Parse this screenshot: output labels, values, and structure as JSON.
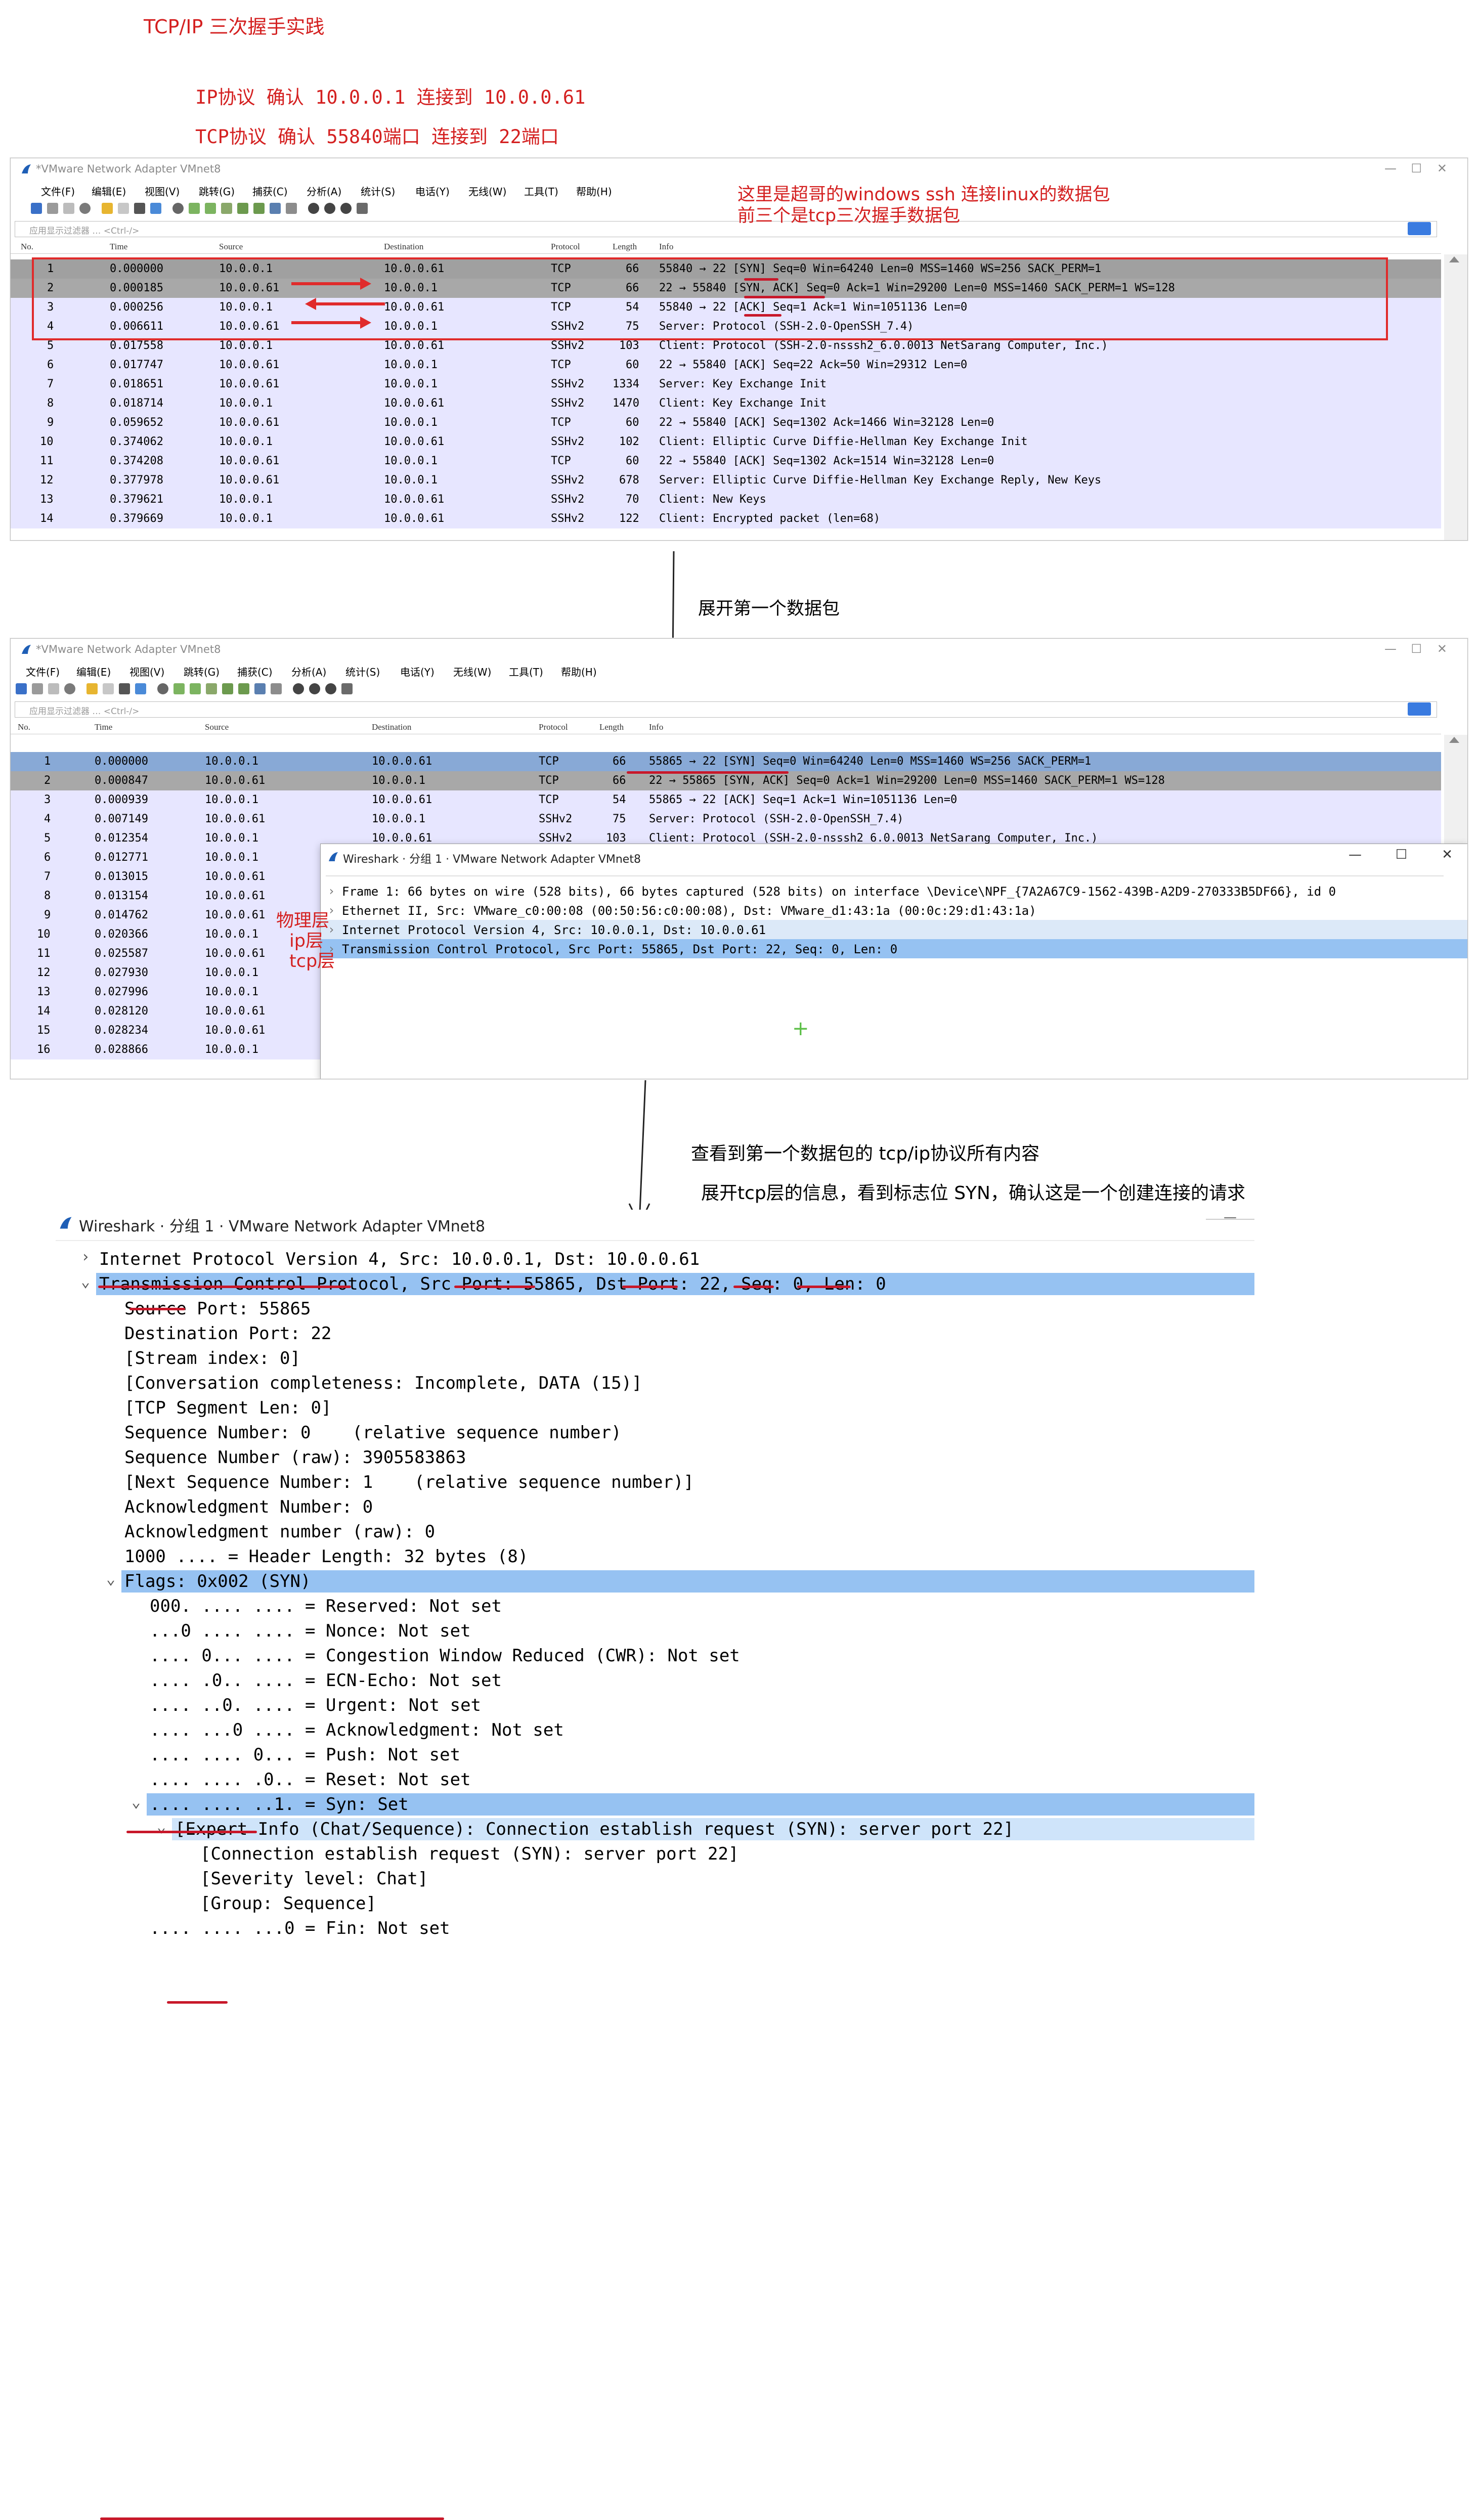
{
  "heading": {
    "title": "TCP/IP 三次握手实践",
    "line1": "IP协议 确认  10.0.0.1  连接到  10.0.0.61",
    "line2": "TCP协议  确认 55840端口  连接到  22端口"
  },
  "annotations": {
    "note1": "这里是超哥的windows  ssh 连接linux的数据包",
    "note2": "前三个是tcp三次握手数据包",
    "expand_first": "展开第一个数据包",
    "view_all": "查看到第一个数据包的 tcp/ip协议所有内容",
    "expand_tcp": "展开tcp层的信息，看到标志位 SYN，确认这是一个创建连接的请求",
    "layer_physical": "物理层",
    "layer_ip": "ip层",
    "layer_tcp": "tcp层"
  },
  "window": {
    "title": "*VMware Network Adapter VMnet8",
    "menu": [
      "文件(F)",
      "编辑(E)",
      "视图(V)",
      "跳转(G)",
      "捕获(C)",
      "分析(A)",
      "统计(S)",
      "电话(Y)",
      "无线(W)",
      "工具(T)",
      "帮助(H)"
    ],
    "filter_placeholder": "应用显示过滤器 … <Ctrl-/>",
    "columns": [
      "No.",
      "Time",
      "Source",
      "Destination",
      "Protocol",
      "Length",
      "Info"
    ],
    "min": "—",
    "max": "☐",
    "close": "✕"
  },
  "packets1": [
    {
      "no": "1",
      "time": "0.000000",
      "src": "10.0.0.1",
      "dst": "10.0.0.61",
      "proto": "TCP",
      "len": "66",
      "info": "55840 → 22 [SYN] Seq=0 Win=64240 Len=0 MSS=1460 WS=256 SACK_PERM=1"
    },
    {
      "no": "2",
      "time": "0.000185",
      "src": "10.0.0.61",
      "dst": "10.0.0.1",
      "proto": "TCP",
      "len": "66",
      "info": "22 → 55840 [SYN, ACK] Seq=0 Ack=1 Win=29200 Len=0 MSS=1460 SACK_PERM=1 WS=128"
    },
    {
      "no": "3",
      "time": "0.000256",
      "src": "10.0.0.1",
      "dst": "10.0.0.61",
      "proto": "TCP",
      "len": "54",
      "info": "55840 → 22 [ACK] Seq=1 Ack=1 Win=1051136 Len=0"
    },
    {
      "no": "4",
      "time": "0.006611",
      "src": "10.0.0.61",
      "dst": "10.0.0.1",
      "proto": "SSHv2",
      "len": "75",
      "info": "Server: Protocol (SSH-2.0-OpenSSH_7.4)"
    },
    {
      "no": "5",
      "time": "0.017558",
      "src": "10.0.0.1",
      "dst": "10.0.0.61",
      "proto": "SSHv2",
      "len": "103",
      "info": "Client: Protocol (SSH-2.0-nsssh2_6.0.0013 NetSarang Computer, Inc.)"
    },
    {
      "no": "6",
      "time": "0.017747",
      "src": "10.0.0.61",
      "dst": "10.0.0.1",
      "proto": "TCP",
      "len": "60",
      "info": "22 → 55840 [ACK] Seq=22 Ack=50 Win=29312 Len=0"
    },
    {
      "no": "7",
      "time": "0.018651",
      "src": "10.0.0.61",
      "dst": "10.0.0.1",
      "proto": "SSHv2",
      "len": "1334",
      "info": "Server: Key Exchange Init"
    },
    {
      "no": "8",
      "time": "0.018714",
      "src": "10.0.0.1",
      "dst": "10.0.0.61",
      "proto": "SSHv2",
      "len": "1470",
      "info": "Client: Key Exchange Init"
    },
    {
      "no": "9",
      "time": "0.059652",
      "src": "10.0.0.61",
      "dst": "10.0.0.1",
      "proto": "TCP",
      "len": "60",
      "info": "22 → 55840 [ACK] Seq=1302 Ack=1466 Win=32128 Len=0"
    },
    {
      "no": "10",
      "time": "0.374062",
      "src": "10.0.0.1",
      "dst": "10.0.0.61",
      "proto": "SSHv2",
      "len": "102",
      "info": "Client: Elliptic Curve Diffie-Hellman Key Exchange Init"
    },
    {
      "no": "11",
      "time": "0.374208",
      "src": "10.0.0.61",
      "dst": "10.0.0.1",
      "proto": "TCP",
      "len": "60",
      "info": "22 → 55840 [ACK] Seq=1302 Ack=1514 Win=32128 Len=0"
    },
    {
      "no": "12",
      "time": "0.377978",
      "src": "10.0.0.61",
      "dst": "10.0.0.1",
      "proto": "SSHv2",
      "len": "678",
      "info": "Server: Elliptic Curve Diffie-Hellman Key Exchange Reply, New Keys"
    },
    {
      "no": "13",
      "time": "0.379621",
      "src": "10.0.0.1",
      "dst": "10.0.0.61",
      "proto": "SSHv2",
      "len": "70",
      "info": "Client: New Keys"
    },
    {
      "no": "14",
      "time": "0.379669",
      "src": "10.0.0.1",
      "dst": "10.0.0.61",
      "proto": "SSHv2",
      "len": "122",
      "info": "Client: Encrypted packet (len=68)"
    }
  ],
  "packets2": [
    {
      "no": "1",
      "time": "0.000000",
      "src": "10.0.0.1",
      "dst": "10.0.0.61",
      "proto": "TCP",
      "len": "66",
      "info": "55865 → 22 [SYN] Seq=0 Win=64240 Len=0 MSS=1460 WS=256 SACK_PERM=1"
    },
    {
      "no": "2",
      "time": "0.000847",
      "src": "10.0.0.61",
      "dst": "10.0.0.1",
      "proto": "TCP",
      "len": "66",
      "info": "22 → 55865 [SYN, ACK] Seq=0 Ack=1 Win=29200 Len=0 MSS=1460 SACK_PERM=1 WS=128"
    },
    {
      "no": "3",
      "time": "0.000939",
      "src": "10.0.0.1",
      "dst": "10.0.0.61",
      "proto": "TCP",
      "len": "54",
      "info": "55865 → 22 [ACK] Seq=1 Ack=1 Win=1051136 Len=0"
    },
    {
      "no": "4",
      "time": "0.007149",
      "src": "10.0.0.61",
      "dst": "10.0.0.1",
      "proto": "SSHv2",
      "len": "75",
      "info": "Server: Protocol (SSH-2.0-OpenSSH_7.4)"
    },
    {
      "no": "5",
      "time": "0.012354",
      "src": "10.0.0.1",
      "dst": "10.0.0.61",
      "proto": "SSHv2",
      "len": "103",
      "info": "Client: Protocol (SSH-2.0-nsssh2_6.0.0013 NetSarang Computer, Inc.)"
    },
    {
      "no": "6",
      "time": "0.012771",
      "src": "10.0.0.1",
      "dst": "",
      "proto": "",
      "len": "",
      "info": ""
    },
    {
      "no": "7",
      "time": "0.013015",
      "src": "10.0.0.61",
      "dst": "",
      "proto": "",
      "len": "",
      "info": ""
    },
    {
      "no": "8",
      "time": "0.013154",
      "src": "10.0.0.61",
      "dst": "",
      "proto": "",
      "len": "",
      "info": ""
    },
    {
      "no": "9",
      "time": "0.014762",
      "src": "10.0.0.61",
      "dst": "",
      "proto": "",
      "len": "",
      "info": ""
    },
    {
      "no": "10",
      "time": "0.020366",
      "src": "10.0.0.1",
      "dst": "",
      "proto": "",
      "len": "",
      "info": ""
    },
    {
      "no": "11",
      "time": "0.025587",
      "src": "10.0.0.61",
      "dst": "",
      "proto": "",
      "len": "",
      "info": ""
    },
    {
      "no": "12",
      "time": "0.027930",
      "src": "10.0.0.1",
      "dst": "",
      "proto": "",
      "len": "",
      "info": ""
    },
    {
      "no": "13",
      "time": "0.027996",
      "src": "10.0.0.1",
      "dst": "",
      "proto": "",
      "len": "",
      "info": ""
    },
    {
      "no": "14",
      "time": "0.028120",
      "src": "10.0.0.61",
      "dst": "",
      "proto": "",
      "len": "",
      "info": ""
    },
    {
      "no": "15",
      "time": "0.028234",
      "src": "10.0.0.61",
      "dst": "",
      "proto": "",
      "len": "",
      "info": ""
    },
    {
      "no": "16",
      "time": "0.028866",
      "src": "10.0.0.1",
      "dst": "",
      "proto": "",
      "len": "",
      "info": ""
    }
  ],
  "popup": {
    "title": "Wireshark · 分组 1 · VMware Network Adapter VMnet8",
    "lines": [
      "Frame 1: 66 bytes on wire (528 bits), 66 bytes captured (528 bits) on interface \\Device\\NPF_{7A2A67C9-1562-439B-A2D9-270333B5DF66}, id 0",
      "Ethernet II, Src: VMware_c0:00:08 (00:50:56:c0:00:08), Dst: VMware_d1:43:1a (00:0c:29:d1:43:1a)",
      "Internet Protocol Version 4, Src: 10.0.0.1, Dst: 10.0.0.61",
      "Transmission Control Protocol, Src Port: 55865, Dst Port: 22, Seq: 0, Len: 0"
    ]
  },
  "detail": {
    "title": "Wireshark · 分组 1 · VMware Network Adapter VMnet8",
    "lines": [
      "Internet Protocol Version 4, Src: 10.0.0.1, Dst: 10.0.0.61",
      "Transmission Control Protocol, Src Port: 55865, Dst Port: 22, Seq: 0, Len: 0",
      "Source Port: 55865",
      "Destination Port: 22",
      "[Stream index: 0]",
      "[Conversation completeness: Incomplete, DATA (15)]",
      "[TCP Segment Len: 0]",
      "Sequence Number: 0    (relative sequence number)",
      "Sequence Number (raw): 3905583863",
      "[Next Sequence Number: 1    (relative sequence number)]",
      "Acknowledgment Number: 0",
      "Acknowledgment number (raw): 0",
      "1000 .... = Header Length: 32 bytes (8)",
      "Flags: 0x002 (SYN)",
      "000. .... .... = Reserved: Not set",
      "...0 .... .... = Nonce: Not set",
      ".... 0... .... = Congestion Window Reduced (CWR): Not set",
      ".... .0.. .... = ECN-Echo: Not set",
      ".... ..0. .... = Urgent: Not set",
      ".... ...0 .... = Acknowledgment: Not set",
      ".... .... 0... = Push: Not set",
      ".... .... .0.. = Reset: Not set",
      ".... .... ..1. = Syn: Set",
      "[Expert Info (Chat/Sequence): Connection establish request (SYN): server port 22]",
      "[Connection establish request (SYN): server port 22]",
      "[Severity level: Chat]",
      "[Group: Sequence]",
      ".... .... ...0 = Fin: Not set"
    ]
  }
}
